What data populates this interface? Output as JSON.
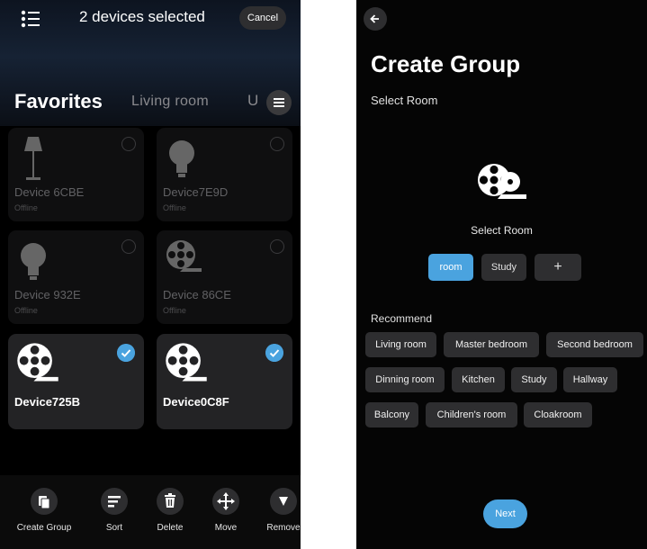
{
  "left": {
    "header": {
      "title": "2 devices selected",
      "cancel_label": "Cancel"
    },
    "tabs": [
      {
        "label": "Favorites",
        "active": true
      },
      {
        "label": "Living room",
        "active": false
      },
      {
        "label": "U",
        "active": false
      }
    ],
    "devices": [
      {
        "name": "Device 6CBE",
        "status": "Offline",
        "icon": "floor-lamp-icon",
        "selected": false
      },
      {
        "name": "Device7E9D",
        "status": "Offline",
        "icon": "bulb-icon",
        "selected": false
      },
      {
        "name": "Device 932E",
        "status": "Offline",
        "icon": "bulb-icon",
        "selected": false
      },
      {
        "name": "Device 86CE",
        "status": "Offline",
        "icon": "film-reel-icon",
        "selected": false
      },
      {
        "name": "Device725B",
        "status": "",
        "icon": "film-reel-icon",
        "selected": true
      },
      {
        "name": "Device0C8F",
        "status": "",
        "icon": "film-reel-icon",
        "selected": true
      }
    ],
    "actions": [
      {
        "label": "Create Group",
        "icon": "create-group-icon"
      },
      {
        "label": "Sort",
        "icon": "sort-icon"
      },
      {
        "label": "Delete",
        "icon": "trash-icon"
      },
      {
        "label": "Move",
        "icon": "move-icon"
      },
      {
        "label": "Remove",
        "icon": "remove-icon"
      }
    ]
  },
  "right": {
    "title": "Create Group",
    "subtitle": "Select Room",
    "room_label": "Select Room",
    "rooms": [
      {
        "label": "room",
        "selected": true
      },
      {
        "label": "Study",
        "selected": false
      }
    ],
    "add_label": "+",
    "recommend_label": "Recommend",
    "recommend": [
      "Living room",
      "Master bedroom",
      "Second bedroom",
      "Dinning room",
      "Kitchen",
      "Study",
      "Hallway",
      "Balcony",
      "Children's room",
      "Cloakroom"
    ],
    "next_label": "Next"
  },
  "colors": {
    "accent": "#4aa3df",
    "background": "#000000",
    "card": "#1c1c1e",
    "chip": "#2e2e30"
  }
}
